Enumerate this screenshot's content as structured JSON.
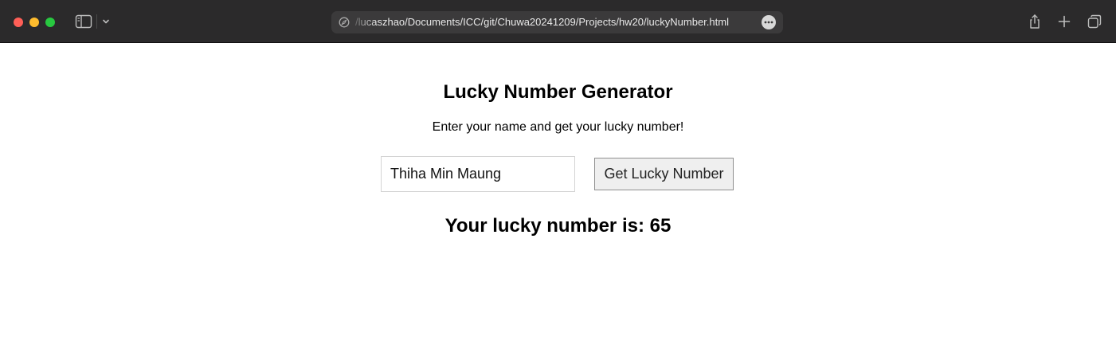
{
  "browser": {
    "url": "/lucaszhao/Documents/ICC/git/Chuwa20241209/Projects/hw20/luckyNumber.html",
    "icons": {
      "close": "close-dot",
      "minimize": "minimize-dot",
      "zoom": "zoom-dot",
      "sidebar": "sidebar-icon",
      "chevron": "chevron-down-icon",
      "site": "compass-icon",
      "more": "more-icon",
      "share": "share-icon",
      "new_tab": "plus-icon",
      "tab_overview": "tabs-icon"
    },
    "colors": {
      "toolbar": "#2b2a2b",
      "close": "#ff5f57",
      "minimize": "#febc2e",
      "zoom": "#28c840"
    }
  },
  "page": {
    "title": "Lucky Number Generator",
    "subtitle": "Enter your name and get your lucky number!",
    "name_input_value": "Thiha Min Maung",
    "button_label": "Get Lucky Number",
    "result_text": "Your lucky number is: 65"
  }
}
